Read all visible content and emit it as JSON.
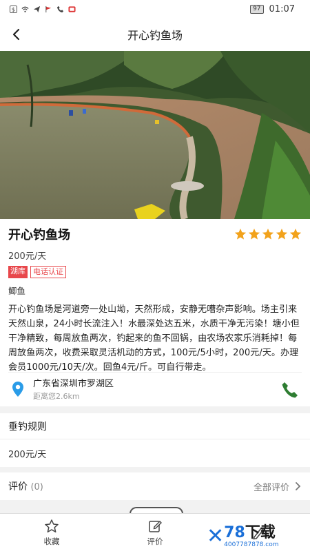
{
  "status": {
    "battery": "97",
    "time": "01:07"
  },
  "nav": {
    "title": "开心钓鱼场"
  },
  "spot": {
    "name": "开心钓鱼场",
    "rating": 5,
    "price": "200元/天",
    "tags": [
      "湖库",
      "电话认证"
    ],
    "fish": "鲫鱼",
    "description": "开心钓鱼场是河道旁一处山坳，天然形成，安静无嘈杂声影响。场主引来天然山泉，24小时长流注入！水最深处达五米，水质干净无污染！塘小但干净精致，每周放鱼两次，钓起来的鱼不回锅，由农场农家乐消耗掉！每周放鱼两次，收费采取灵活机动的方式，100元/5小时，200元/天。办理会员1000元/10天/次。回鱼4元/斤。可自行带走。",
    "address": "广东省深圳市罗湖区",
    "distance": "距离您2.6km"
  },
  "rules": {
    "heading": "垂钓规则",
    "value": "200元/天"
  },
  "review": {
    "label": "评价",
    "count": "(0)",
    "all": "全部评价"
  },
  "tabbar": {
    "favorite": "收藏",
    "comment": "评价"
  },
  "watermark": {
    "main_a": "78",
    "main_b": "下载",
    "sub": "4007787878.com"
  },
  "colors": {
    "accent": "#e8474b",
    "star": "#f2a21b",
    "pin": "#2a9ce8",
    "phone": "#2e7d32"
  }
}
